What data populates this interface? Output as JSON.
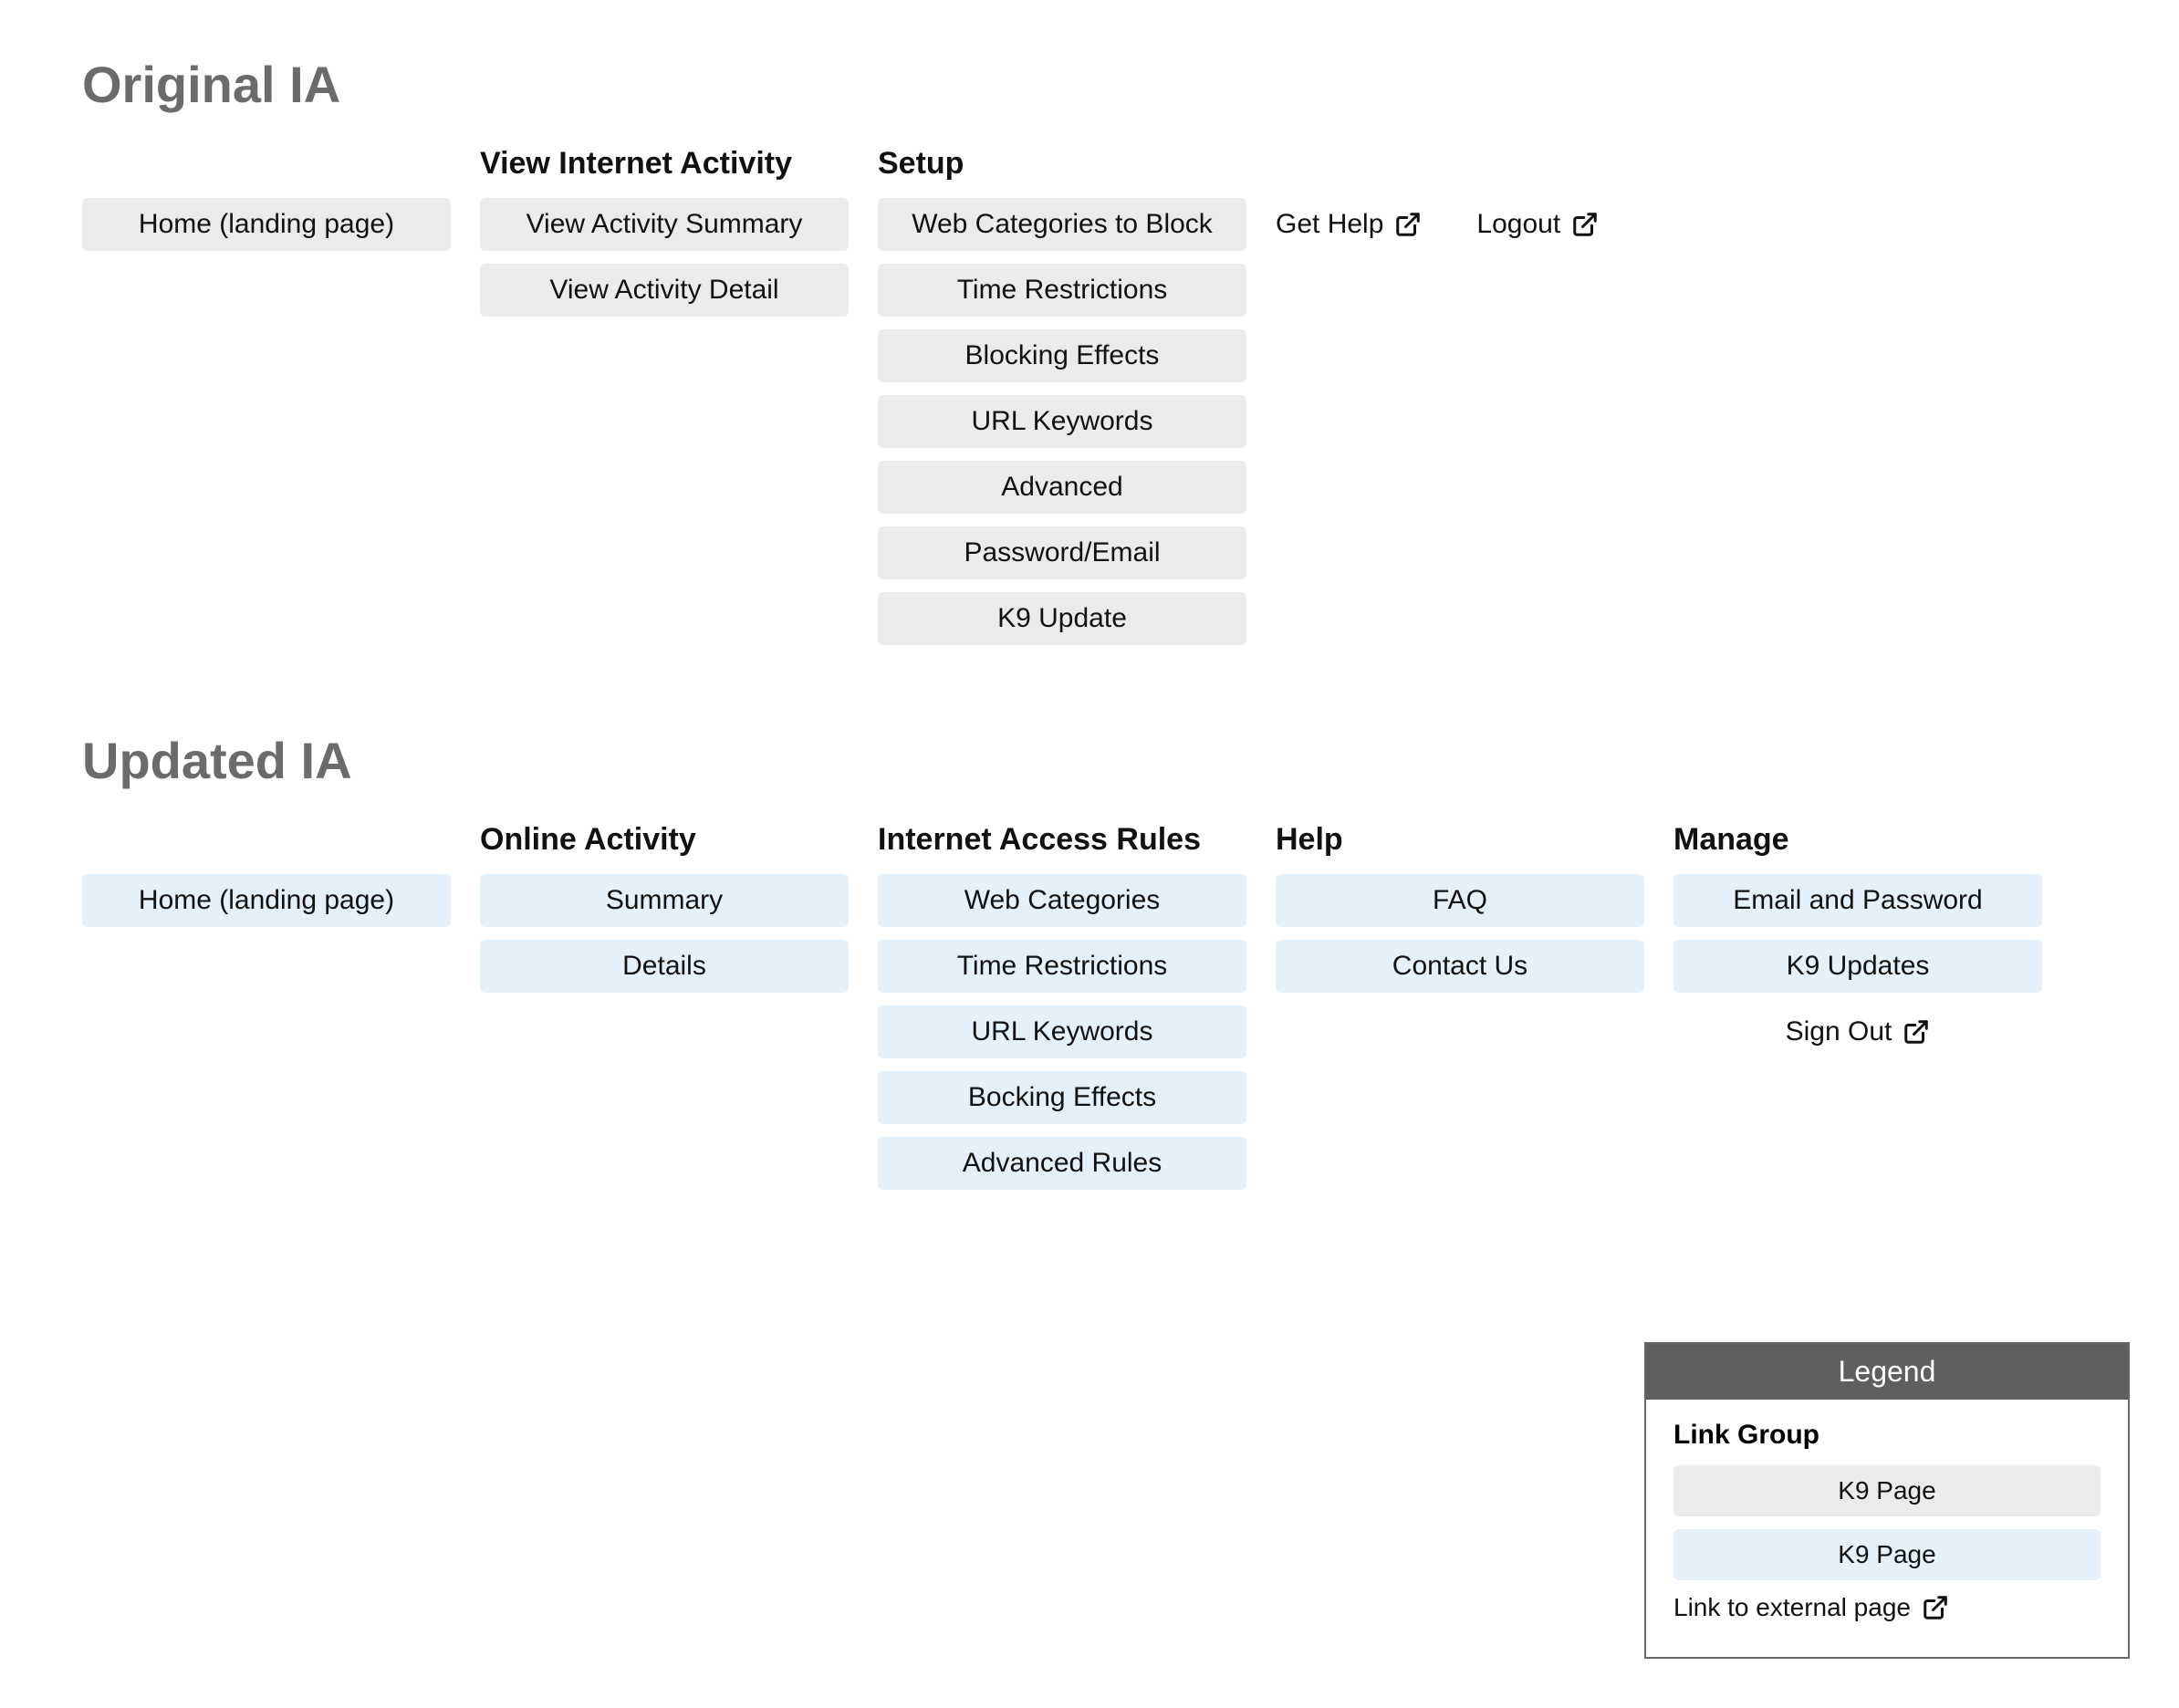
{
  "sections": {
    "original": {
      "title": "Original IA",
      "columns": [
        {
          "heading": "",
          "items": [
            {
              "kind": "pill-gray",
              "label": "Home (landing page)"
            }
          ]
        },
        {
          "heading": "View Internet Activity",
          "items": [
            {
              "kind": "pill-gray",
              "label": "View Activity Summary"
            },
            {
              "kind": "pill-gray",
              "label": "View Activity Detail"
            }
          ]
        },
        {
          "heading": "Setup",
          "items": [
            {
              "kind": "pill-gray",
              "label": "Web Categories to Block"
            },
            {
              "kind": "pill-gray",
              "label": "Time Restrictions"
            },
            {
              "kind": "pill-gray",
              "label": "Blocking Effects"
            },
            {
              "kind": "pill-gray",
              "label": "URL Keywords"
            },
            {
              "kind": "pill-gray",
              "label": "Advanced"
            },
            {
              "kind": "pill-gray",
              "label": "Password/Email"
            },
            {
              "kind": "pill-gray",
              "label": "K9 Update"
            }
          ]
        },
        {
          "heading": "",
          "toplinks": [
            {
              "label": "Get Help"
            },
            {
              "label": "Logout"
            }
          ]
        }
      ]
    },
    "updated": {
      "title": "Updated IA",
      "columns": [
        {
          "heading": "",
          "items": [
            {
              "kind": "pill-blue",
              "label": "Home (landing page)"
            }
          ]
        },
        {
          "heading": "Online Activity",
          "items": [
            {
              "kind": "pill-blue",
              "label": "Summary"
            },
            {
              "kind": "pill-blue",
              "label": "Details"
            }
          ]
        },
        {
          "heading": "Internet Access Rules",
          "items": [
            {
              "kind": "pill-blue",
              "label": "Web Categories"
            },
            {
              "kind": "pill-blue",
              "label": "Time Restrictions"
            },
            {
              "kind": "pill-blue",
              "label": "URL Keywords"
            },
            {
              "kind": "pill-blue",
              "label": "Bocking Effects"
            },
            {
              "kind": "pill-blue",
              "label": "Advanced Rules"
            }
          ]
        },
        {
          "heading": "Help",
          "items": [
            {
              "kind": "pill-blue",
              "label": "FAQ"
            },
            {
              "kind": "pill-blue",
              "label": "Contact Us"
            }
          ]
        },
        {
          "heading": "Manage",
          "items": [
            {
              "kind": "pill-blue",
              "label": "Email and Password"
            },
            {
              "kind": "pill-blue",
              "label": "K9 Updates"
            },
            {
              "kind": "ext",
              "label": "Sign Out"
            }
          ]
        }
      ]
    }
  },
  "legend": {
    "title": "Legend",
    "group_heading": "Link Group",
    "gray_label": "K9 Page",
    "blue_label": "K9 Page",
    "ext_label": "Link to external page"
  }
}
